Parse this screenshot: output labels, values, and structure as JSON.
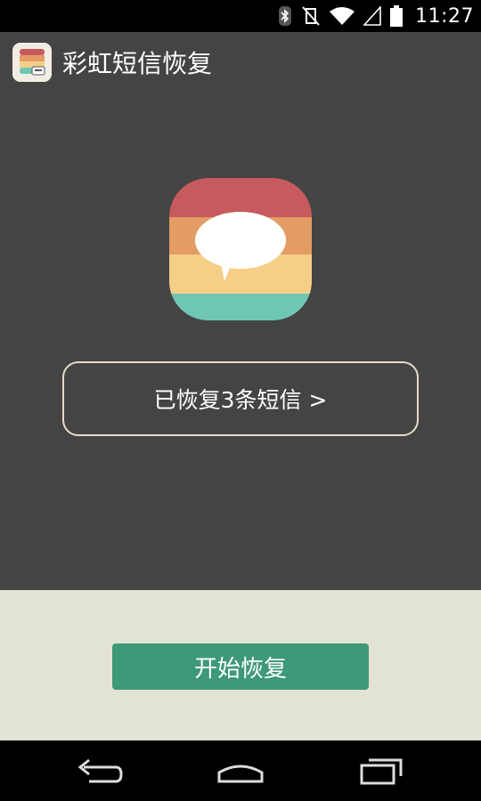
{
  "status_bar": {
    "time": "11:27",
    "icons": [
      "bluetooth-icon",
      "vibrate-icon",
      "wifi-icon",
      "signal-icon",
      "battery-icon"
    ]
  },
  "action_bar": {
    "title": "彩虹短信恢复",
    "icon": "rainbow-sms-app-icon"
  },
  "main": {
    "logo": "rainbow-message-bubble-logo",
    "recovered_label": "已恢复3条短信 >"
  },
  "bottom": {
    "start_label": "开始恢复"
  },
  "nav": {
    "icons": [
      "back-icon",
      "home-icon",
      "recent-apps-icon"
    ]
  },
  "colors": {
    "background": "#444444",
    "bottom_panel": "#e2e2d5",
    "button_green": "#3e9978",
    "stripe_red": "#c65a5e",
    "stripe_orange": "#e39c63",
    "stripe_yellow": "#f5cf88",
    "stripe_teal": "#6fc7b3"
  }
}
